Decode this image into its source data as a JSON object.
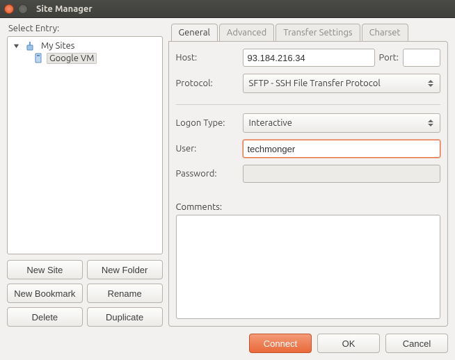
{
  "window": {
    "title": "Site Manager"
  },
  "left": {
    "heading": "Select Entry:",
    "root": "My Sites",
    "selected_site": "Google VM",
    "buttons": {
      "new_site": "New Site",
      "new_folder": "New Folder",
      "new_bookmark": "New Bookmark",
      "rename": "Rename",
      "delete": "Delete",
      "duplicate": "Duplicate"
    }
  },
  "tabs": {
    "general": "General",
    "advanced": "Advanced",
    "transfer": "Transfer Settings",
    "charset": "Charset"
  },
  "form": {
    "host_label": "Host:",
    "host_value": "93.184.216.34",
    "port_label": "Port:",
    "port_value": "",
    "protocol_label": "Protocol:",
    "protocol_value": "SFTP - SSH File Transfer Protocol",
    "logon_label": "Logon Type:",
    "logon_value": "Interactive",
    "user_label": "User:",
    "user_value": "techmonger",
    "password_label": "Password:",
    "password_value": "",
    "comments_label": "Comments:",
    "comments_value": ""
  },
  "dialog": {
    "connect": "Connect",
    "ok": "OK",
    "cancel": "Cancel"
  }
}
